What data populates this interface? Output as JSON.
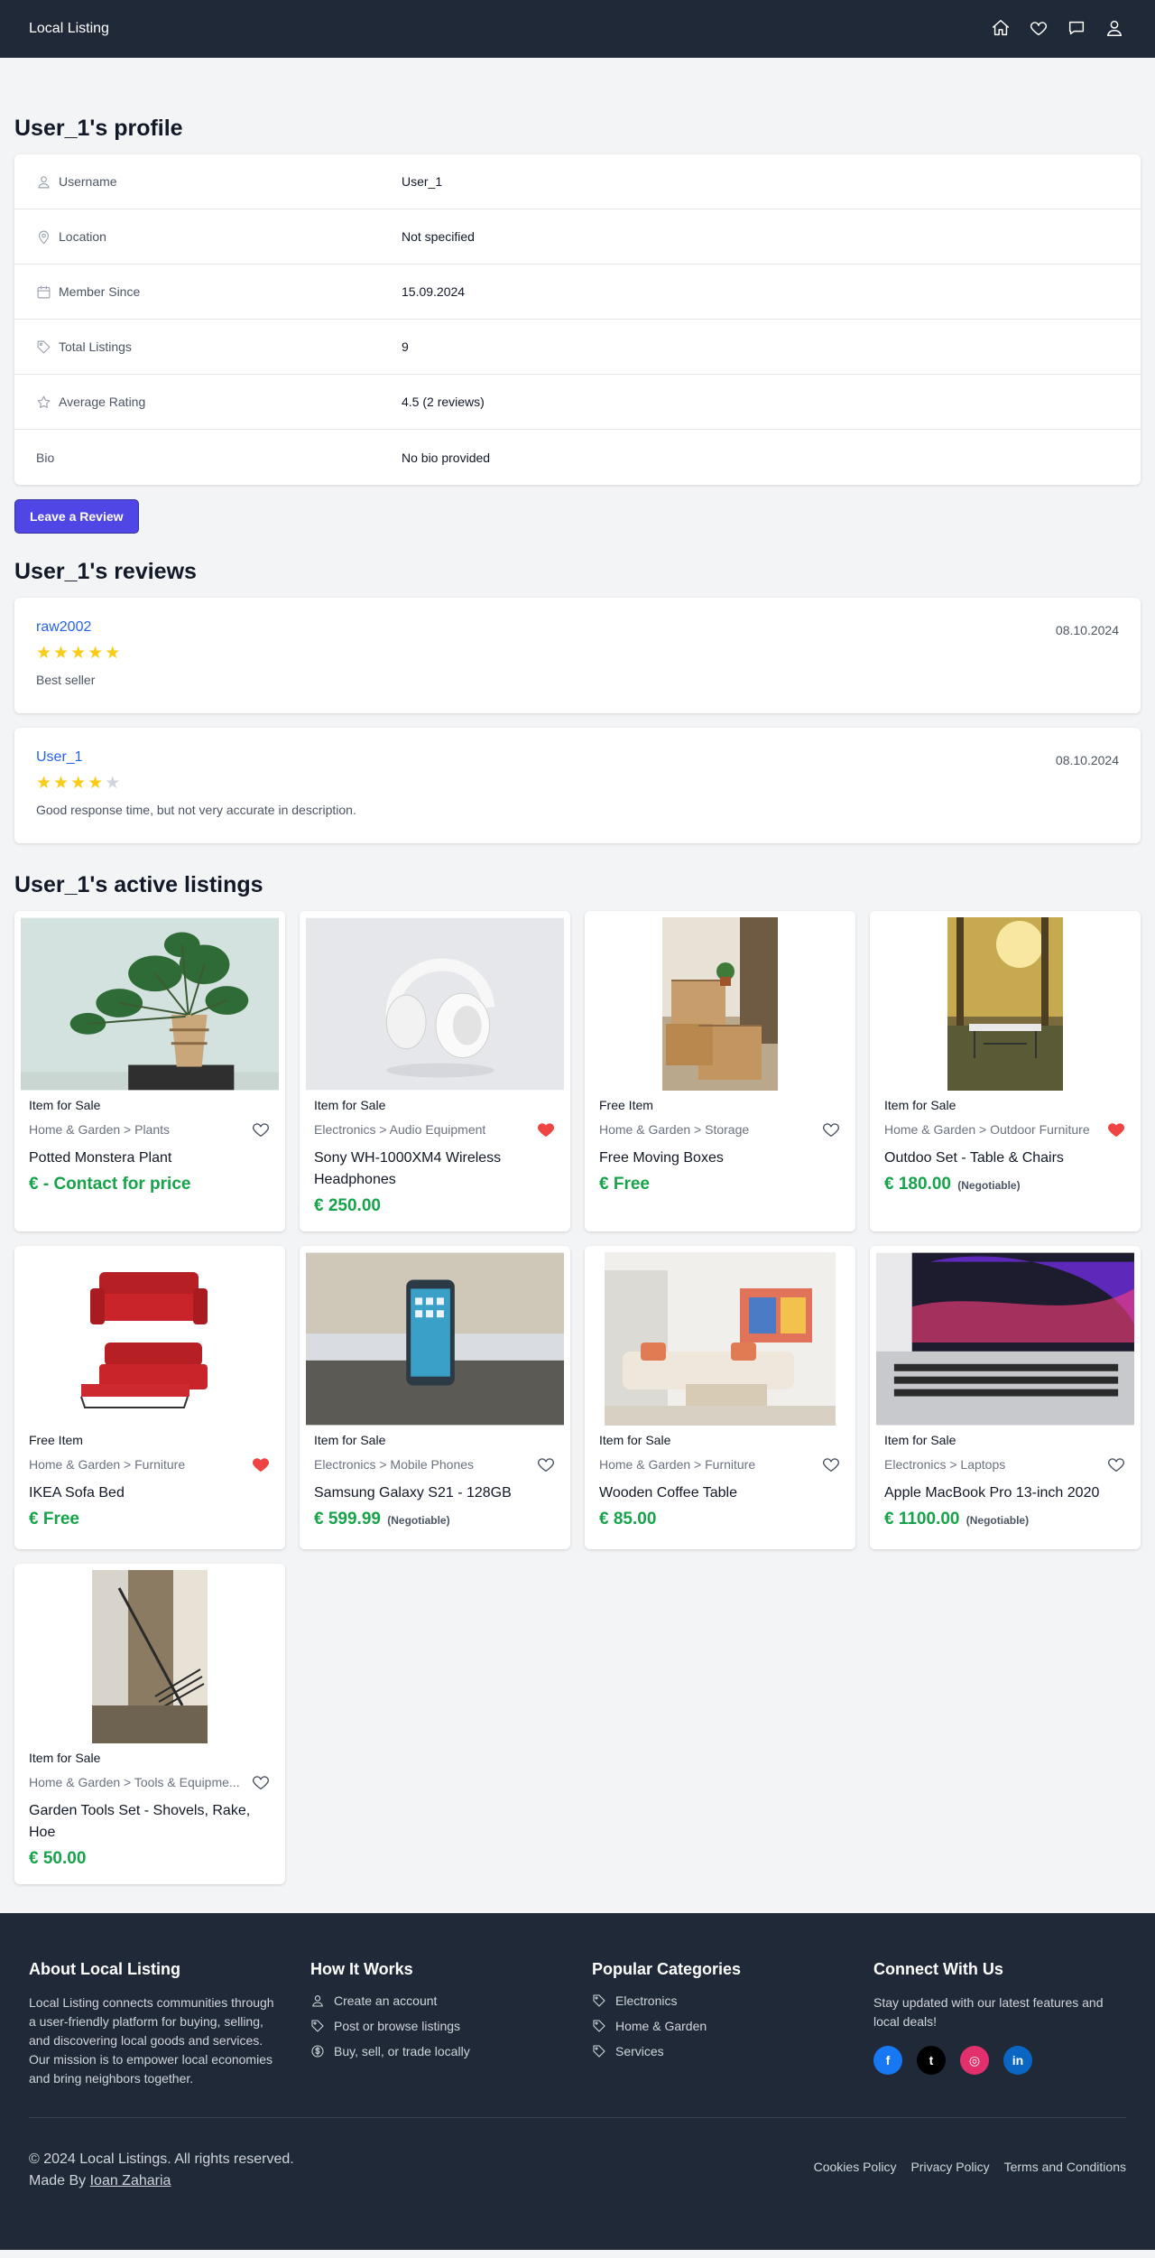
{
  "nav": {
    "brand": "Local Listing",
    "icons": [
      "home-icon",
      "heart-icon",
      "chat-icon",
      "user-icon"
    ]
  },
  "profile": {
    "title": "User_1's profile",
    "rows": [
      {
        "icon": "user-icon",
        "label": "Username",
        "value": "User_1"
      },
      {
        "icon": "location-pin-icon",
        "label": "Location",
        "value": "Not specified"
      },
      {
        "icon": "calendar-icon",
        "label": "Member Since",
        "value": "15.09.2024"
      },
      {
        "icon": "tag-icon",
        "label": "Total Listings",
        "value": "9"
      },
      {
        "icon": "star-icon",
        "label": "Average Rating",
        "value": "4.5 (2 reviews)"
      },
      {
        "icon": "",
        "label": "Bio",
        "value": "No bio provided"
      }
    ],
    "review_button": "Leave a Review"
  },
  "reviews": {
    "title": "User_1's reviews",
    "items": [
      {
        "author": "raw2002",
        "date": "08.10.2024",
        "rating": 5,
        "text": "Best seller"
      },
      {
        "author": "User_1",
        "date": "08.10.2024",
        "rating": 4,
        "text": "Good response time, but not very accurate in description."
      }
    ]
  },
  "listings": {
    "title": "User_1's active listings",
    "items": [
      {
        "type": "Item for Sale",
        "category": "Home & Garden > Plants",
        "title": "Potted Monstera Plant",
        "price": "€ - Contact for price",
        "negotiable": "",
        "favorited": false,
        "image": "monstera-plant-photo"
      },
      {
        "type": "Item for Sale",
        "category": "Electronics > Audio Equipment",
        "title": "Sony WH-1000XM4 Wireless Headphones",
        "price": "€ 250.00",
        "negotiable": "",
        "favorited": true,
        "image": "headphones-photo"
      },
      {
        "type": "Free Item",
        "category": "Home & Garden > Storage",
        "title": "Free Moving Boxes",
        "price": "€ Free",
        "negotiable": "",
        "favorited": false,
        "image": "moving-boxes-photo"
      },
      {
        "type": "Item for Sale",
        "category": "Home & Garden > Outdoor Furniture",
        "title": "Outdoo Set - Table & Chairs",
        "price": "€ 180.00",
        "negotiable": "(Negotiable)",
        "favorited": true,
        "image": "outdoor-table-photo"
      },
      {
        "type": "Free Item",
        "category": "Home & Garden > Furniture",
        "title": "IKEA Sofa Bed",
        "price": "€ Free",
        "negotiable": "",
        "favorited": true,
        "image": "red-sofa-bed-photo"
      },
      {
        "type": "Item for Sale",
        "category": "Electronics > Mobile Phones",
        "title": "Samsung Galaxy S21 - 128GB",
        "price": "€ 599.99",
        "negotiable": "(Negotiable)",
        "favorited": false,
        "image": "smartphone-photo"
      },
      {
        "type": "Item for Sale",
        "category": "Home & Garden > Furniture",
        "title": "Wooden Coffee Table",
        "price": "€ 85.00",
        "negotiable": "",
        "favorited": false,
        "image": "living-room-photo"
      },
      {
        "type": "Item for Sale",
        "category": "Electronics > Laptops",
        "title": "Apple MacBook Pro 13-inch 2020",
        "price": "€ 1100.00",
        "negotiable": "(Negotiable)",
        "favorited": false,
        "image": "macbook-photo"
      },
      {
        "type": "Item for Sale",
        "category": "Home & Garden > Tools & Equipme...",
        "title": "Garden Tools Set - Shovels, Rake, Hoe",
        "price": "€ 50.00",
        "negotiable": "",
        "favorited": false,
        "image": "garden-rake-photo"
      }
    ]
  },
  "footer": {
    "about_title": "About Local Listing",
    "about_text": "Local Listing connects communities through a user-friendly platform for buying, selling, and discovering local goods and services. Our mission is to empower local economies and bring neighbors together.",
    "how_title": "How It Works",
    "how_items": [
      {
        "icon": "user-icon",
        "label": "Create an account"
      },
      {
        "icon": "tag-icon",
        "label": "Post or browse listings"
      },
      {
        "icon": "dollar-icon",
        "label": "Buy, sell, or trade locally"
      }
    ],
    "categories_title": "Popular Categories",
    "categories": [
      {
        "icon": "tag-icon",
        "label": "Electronics"
      },
      {
        "icon": "tag-icon",
        "label": "Home & Garden"
      },
      {
        "icon": "tag-icon",
        "label": "Services"
      }
    ],
    "connect_title": "Connect With Us",
    "connect_text": "Stay updated with our latest features and local deals!",
    "socials": [
      {
        "name": "facebook",
        "glyph": "f",
        "color": "#1877f2"
      },
      {
        "name": "twitter",
        "glyph": "t",
        "color": "#000000"
      },
      {
        "name": "instagram",
        "glyph": "◎",
        "color": "#e1306c"
      },
      {
        "name": "linkedin",
        "glyph": "in",
        "color": "#0a66c2"
      }
    ],
    "copyright": "© 2024 Local Listings. All rights reserved.",
    "made_by": "Made By",
    "author": "Ioan Zaharia",
    "links": [
      "Cookies Policy",
      "Privacy Policy",
      "Terms and Conditions"
    ]
  },
  "colors": {
    "nav_bg": "#1f2937",
    "accent": "#4f46e5",
    "link": "#2563eb",
    "price": "#16a34a",
    "star": "#facc15",
    "favorite": "#ef4444"
  }
}
